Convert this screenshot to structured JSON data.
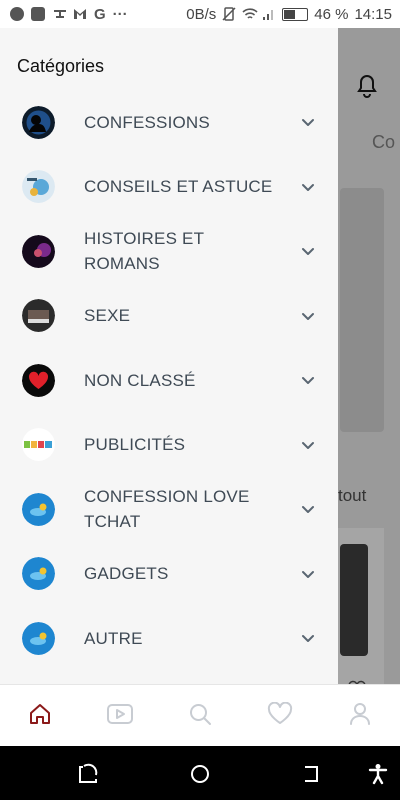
{
  "statusbar": {
    "network_speed": "0B/s",
    "battery_percent": "46 %",
    "time": "14:15",
    "app_icons": [
      "messenger-icon",
      "youtube-icon",
      "drone-icon",
      "gmail-icon",
      "google-icon",
      "more-icon"
    ]
  },
  "background": {
    "tab_text": "Co",
    "section_label": "tout"
  },
  "drawer": {
    "title": "Catégories",
    "categories": [
      {
        "label": "CONFESSIONS"
      },
      {
        "label": "CONSEILS ET ASTUCE"
      },
      {
        "label": "HISTOIRES ET ROMANS"
      },
      {
        "label": "SEXE"
      },
      {
        "label": "NON CLASSÉ"
      },
      {
        "label": "PUBLICITÉS"
      },
      {
        "label": "CONFESSION LOVE TCHAT"
      },
      {
        "label": "GADGETS"
      },
      {
        "label": "AUTRE"
      }
    ]
  },
  "bottomnav": {
    "items": [
      "home-icon",
      "video-icon",
      "search-icon",
      "heart-icon",
      "profile-icon"
    ],
    "active": "home-icon",
    "active_color": "#8b1a1a",
    "inactive_color": "#c8ccd2"
  }
}
